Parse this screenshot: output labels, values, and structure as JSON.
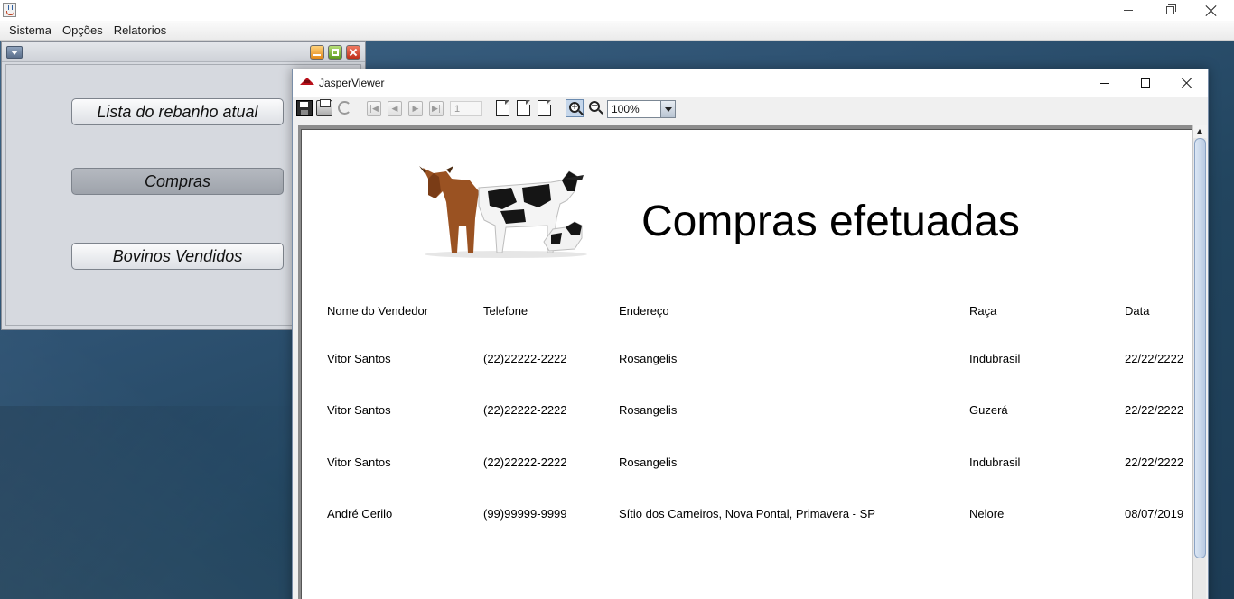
{
  "menubar": {
    "items": [
      "Sistema",
      "Opções",
      "Relatorios"
    ]
  },
  "internal_frame": {
    "buttons": {
      "rebanho": "Lista do rebanho atual",
      "compras": "Compras",
      "vendidos": "Bovinos Vendidos"
    }
  },
  "jasper": {
    "title": "JasperViewer",
    "toolbar": {
      "page_number": "1",
      "zoom": "100%"
    },
    "report": {
      "title": "Compras efetuadas",
      "columns": [
        "Nome do Vendedor",
        "Telefone",
        "Endereço",
        "Raça",
        "Data"
      ],
      "rows": [
        [
          "Vitor Santos",
          "(22)22222-2222",
          "Rosangelis",
          "Indubrasil",
          "22/22/2222"
        ],
        [
          "Vitor Santos",
          "(22)22222-2222",
          "Rosangelis",
          "Guzerá",
          "22/22/2222"
        ],
        [
          "Vitor Santos",
          "(22)22222-2222",
          "Rosangelis",
          "Indubrasil",
          "22/22/2222"
        ],
        [
          "André Cerilo",
          "(99)99999-9999",
          "Sítio dos Carneiros, Nova Pontal, Primavera - SP",
          "Nelore",
          "08/07/2019"
        ]
      ]
    }
  }
}
